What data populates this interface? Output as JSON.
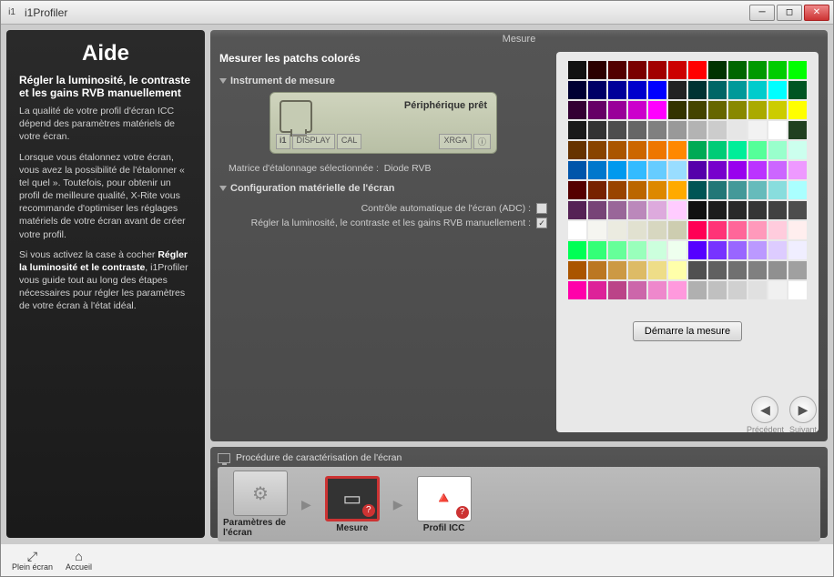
{
  "window": {
    "title": "i1Profiler"
  },
  "section_title": "Mesure",
  "help": {
    "title": "Aide",
    "subtitle": "Régler la luminosité, le contraste et les gains RVB manuellement",
    "p1": "La qualité de votre profil d'écran ICC dépend des paramètres matériels de votre écran.",
    "p2": "Lorsque vous étalonnez votre écran, vous avez la possibilité de l'étalonner « tel quel ». Toutefois, pour obtenir un profil de meilleure qualité, X-Rite vous recommande d'optimiser les réglages matériels de votre écran avant de créer votre profil.",
    "p3_a": "Si vous activez la case à cocher ",
    "p3_strong": "Régler la luminosité et le contraste",
    "p3_b": ", i1Profiler vous guide tout au long des étapes nécessaires pour régler les paramètres de votre écran à l'état idéal."
  },
  "main": {
    "heading": "Mesurer les patchs colorés",
    "instrument_sub": "Instrument de mesure",
    "device_status": "Périphérique prêt",
    "device_tabs": {
      "display": "DISPLAY",
      "cal": "CAL",
      "xrga": "XRGA"
    },
    "matrix_label": "Matrice d'étalonnage sélectionnée :",
    "matrix_value": "Diode RVB",
    "config_sub": "Configuration matérielle de l'écran",
    "cfg_adc": "Contrôle automatique de l'écran (ADC) :",
    "cfg_manual": "Régler la luminosité, le contraste et les gains RVB manuellement :",
    "adc_checked": false,
    "manual_checked": true,
    "start_button": "Démarre la mesure"
  },
  "nav": {
    "prev": "Précédent",
    "next": "Suivant"
  },
  "workflow": {
    "title": "Procédure de caractérisation de l'écran",
    "steps": [
      {
        "label": "Paramètres de l'écran"
      },
      {
        "label": "Mesure"
      },
      {
        "label": "Profil ICC"
      }
    ],
    "active_index": 1
  },
  "footer": {
    "fullscreen": "Plein écran",
    "home": "Accueil"
  },
  "patches": [
    "#121212",
    "#2b0000",
    "#520000",
    "#7a0000",
    "#a20000",
    "#cc0000",
    "#ff0000",
    "#003300",
    "#006600",
    "#009900",
    "#00cc00",
    "#00ff00",
    "#000033",
    "#000066",
    "#000099",
    "#0000cc",
    "#0000ff",
    "#222222",
    "#003333",
    "#006666",
    "#009999",
    "#00cccc",
    "#00ffff",
    "#005522",
    "#330033",
    "#660066",
    "#990099",
    "#cc00cc",
    "#ff00ff",
    "#333300",
    "#444400",
    "#666600",
    "#888800",
    "#aaaa00",
    "#cccc00",
    "#ffff00",
    "#1a1a1a",
    "#333333",
    "#4d4d4d",
    "#666666",
    "#808080",
    "#999999",
    "#b3b3b3",
    "#cccccc",
    "#e6e6e6",
    "#f2f2f2",
    "#ffffff",
    "#204020",
    "#663300",
    "#884400",
    "#aa5500",
    "#cc6600",
    "#ee7700",
    "#ff8800",
    "#00aa55",
    "#00cc77",
    "#00ee99",
    "#55ff99",
    "#99ffcc",
    "#ccffee",
    "#0055aa",
    "#0077cc",
    "#0099ee",
    "#33bbff",
    "#66ccff",
    "#99ddff",
    "#5500aa",
    "#7700cc",
    "#9900ee",
    "#bb33ff",
    "#cc66ff",
    "#ee99ff",
    "#550000",
    "#772200",
    "#994400",
    "#bb6600",
    "#dd8800",
    "#ffaa00",
    "#005555",
    "#227777",
    "#449999",
    "#66bbbb",
    "#88dddd",
    "#aaffff",
    "#552255",
    "#774477",
    "#996699",
    "#bb88bb",
    "#ddaadd",
    "#ffccff",
    "#111111",
    "#1d1d1d",
    "#292929",
    "#353535",
    "#414141",
    "#4d4d4d",
    "#ffffff",
    "#f5f5f0",
    "#ebebe0",
    "#e1e1d0",
    "#d7d7c0",
    "#cdcdb0",
    "#ff0055",
    "#ff3377",
    "#ff6699",
    "#ff99bb",
    "#ffccdd",
    "#ffeeee",
    "#00ff55",
    "#33ff77",
    "#66ff99",
    "#99ffbb",
    "#ccffdd",
    "#eeffee",
    "#5500ff",
    "#7733ff",
    "#9966ff",
    "#bb99ff",
    "#ddccff",
    "#f0eeff",
    "#aa5500",
    "#bb7722",
    "#cc9944",
    "#ddbb66",
    "#eedd88",
    "#ffffaa",
    "#505050",
    "#606060",
    "#707070",
    "#808080",
    "#909090",
    "#a0a0a0",
    "#ff00aa",
    "#dd2299",
    "#bb4488",
    "#cc66aa",
    "#ee88cc",
    "#ff99dd",
    "#b0b0b0",
    "#c0c0c0",
    "#d0d0d0",
    "#e0e0e0",
    "#f0f0f0",
    "#ffffff"
  ]
}
